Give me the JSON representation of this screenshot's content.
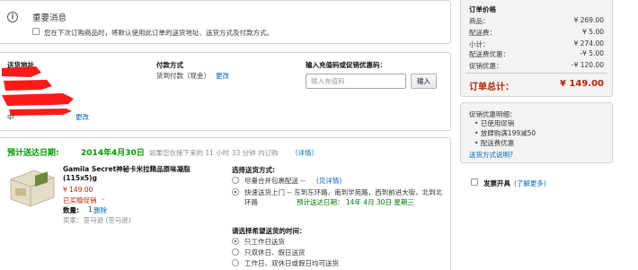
{
  "notice": {
    "title": "重要消息",
    "checkbox_label": "您在下次订购商品时，将默认使用此订单的送货地址、送货方式及付款方式。"
  },
  "address": {
    "label": "送货地址",
    "change": "更改"
  },
  "payment": {
    "label": "付款方式",
    "method": "货到付款（现金）",
    "change": "更改"
  },
  "promo": {
    "label": "输入充值码或促销优惠码：",
    "placeholder": "输入充值码",
    "button": "输入"
  },
  "delivery": {
    "heading": "预计送达日期:",
    "date": "2014年4月30日",
    "note_prefix": "如果您在接下来的 11 小时 33 分钟 内订购",
    "details": "（详情）"
  },
  "item": {
    "title": "Gamila Secret神秘卡米拉精品原味凝脂(115x5)g",
    "price": "¥ 149.00",
    "status": "已买赠促销",
    "qty_label": "数量:",
    "qty_value": "1",
    "delete": "删除",
    "seller": "卖家：亚马逊 (亚马逊)"
  },
  "shipping": {
    "label": "选择送货方式:",
    "options": [
      {
        "text": "尽量合并包裹配送 -- ",
        "link": "(见详情)",
        "selected": false
      },
      {
        "text": "快速送货上门 -- 东到东环路，南到学苑路，西到前进大街，北到北环路",
        "green": "预计送达日期： 14年 4月 30日 星期三",
        "selected": true
      }
    ]
  },
  "time": {
    "label": "请选择希望送货的时间：",
    "options": [
      {
        "text": "只工作日送货",
        "selected": true
      },
      {
        "text": "只双休日、假日送货",
        "selected": false
      },
      {
        "text": "工作日、双休日或假日均可送货",
        "selected": false
      }
    ]
  },
  "summary": {
    "title": "订单价格",
    "rows": [
      {
        "label": "商品：",
        "value": "¥ 269.00"
      },
      {
        "label": "配送费：",
        "value": "¥ 5.00"
      },
      {
        "label": "小计：",
        "value": "¥ 274.00"
      },
      {
        "label": "配送费优惠：",
        "value": "-¥ 5.00"
      },
      {
        "label": "促销优惠：",
        "value": "-¥ 120.00"
      }
    ],
    "total_label": "订单总计：",
    "total_value": "¥ 149.00",
    "promo_title": "促销优惠明细：",
    "promo_items": [
      "已使用促销",
      "放肆购满199减50",
      "配送费优惠"
    ],
    "shipping_link": "送货方式说明?",
    "invoice_label": "发票开具",
    "invoice_link": "(了解更多)"
  }
}
